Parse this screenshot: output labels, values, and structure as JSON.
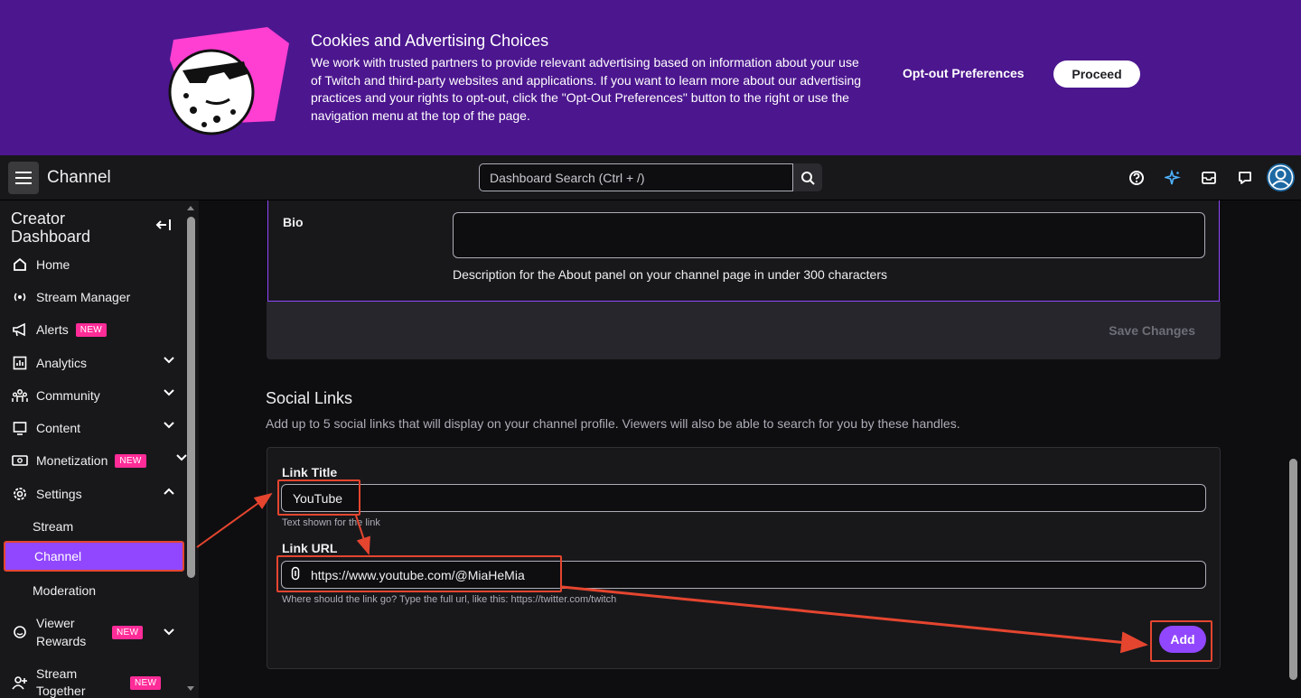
{
  "cookie_banner": {
    "title": "Cookies and Advertising Choices",
    "text": "We work with trusted partners to provide relevant advertising based on information about your use of Twitch and third-party websites and applications. If you want to learn more about our advertising practices and your rights to opt-out, click the \"Opt-Out Preferences\" button to the right or use the navigation menu at the top of the page.",
    "optout_label": "Opt-out Preferences",
    "proceed_label": "Proceed"
  },
  "topnav": {
    "title": "Channel",
    "search_placeholder": "Dashboard Search (Ctrl + /)",
    "icons": [
      "menu-icon",
      "search-icon",
      "help-icon",
      "sparkle-icon",
      "inbox-icon",
      "whispers-icon",
      "avatar"
    ]
  },
  "sidebar": {
    "title": "Creator Dashboard",
    "items": [
      {
        "label": "Home",
        "icon": "home-icon"
      },
      {
        "label": "Stream Manager",
        "icon": "broadcast-icon"
      },
      {
        "label": "Alerts",
        "icon": "megaphone-icon",
        "badge": "NEW"
      },
      {
        "label": "Analytics",
        "icon": "analytics-icon"
      },
      {
        "label": "Community",
        "icon": "community-icon"
      },
      {
        "label": "Content",
        "icon": "content-icon"
      },
      {
        "label": "Monetization",
        "icon": "money-icon",
        "badge": "NEW"
      },
      {
        "label": "Settings",
        "icon": "gear-icon"
      }
    ],
    "settings_sub": [
      "Stream",
      "Channel",
      "Moderation"
    ],
    "more": [
      {
        "label": "Viewer Rewards",
        "badge": "NEW"
      },
      {
        "label": "Stream Together",
        "badge": "NEW"
      }
    ]
  },
  "bio": {
    "label": "Bio",
    "help": "Description for the About panel on your channel page in under 300 characters",
    "save_label": "Save Changes"
  },
  "social": {
    "title": "Social Links",
    "description": "Add up to 5 social links that will display on your channel profile. Viewers will also be able to search for you by these handles.",
    "link_title_label": "Link Title",
    "link_title_value": "YouTube",
    "link_title_help": "Text shown for the link",
    "link_url_label": "Link URL",
    "link_url_value": "https://www.youtube.com/@MiaHeMia",
    "link_url_help": "Where should the link go? Type the full url, like this: https://twitter.com/twitch",
    "add_label": "Add"
  },
  "colors": {
    "banner": "#4c168f",
    "accent": "#9147ff",
    "badge": "#ff2c98",
    "annotation": "#e5452f"
  }
}
